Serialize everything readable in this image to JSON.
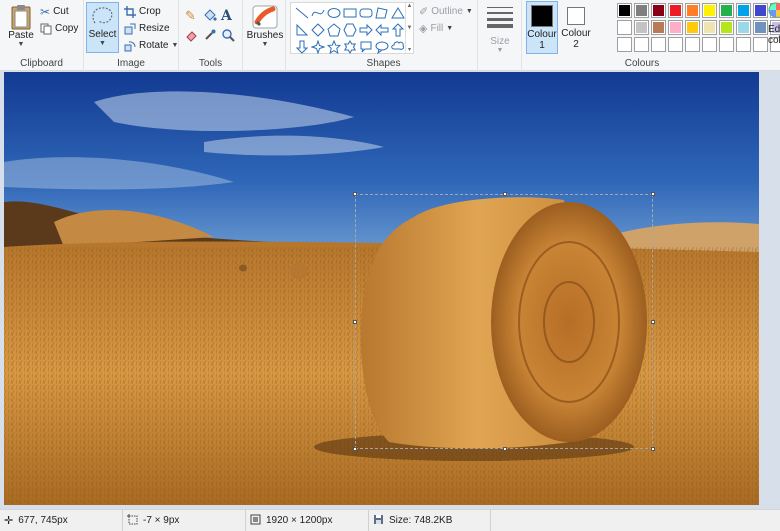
{
  "clipboard": {
    "paste": "Paste",
    "cut": "Cut",
    "copy": "Copy",
    "label": "Clipboard"
  },
  "image": {
    "select": "Select",
    "crop": "Crop",
    "resize": "Resize",
    "rotate": "Rotate",
    "label": "Image"
  },
  "tools": {
    "label": "Tools",
    "items": [
      "pencil-icon",
      "fill-bucket-icon",
      "text-icon",
      "eraser-icon",
      "color-picker-icon",
      "magnifier-icon"
    ]
  },
  "brushes": {
    "label": "Brushes"
  },
  "shapes": {
    "label": "Shapes",
    "outline": "Outline",
    "fill": "Fill"
  },
  "size": {
    "label": "Size"
  },
  "colours": {
    "label": "Colours",
    "colour1": {
      "line1": "Colour",
      "line2": "1",
      "value": "#000000"
    },
    "colour2": {
      "line1": "Colour",
      "line2": "2",
      "value": "#ffffff"
    },
    "edit": {
      "line1": "Ed",
      "line2": "colo"
    },
    "palette": [
      "#000000",
      "#7f7f7f",
      "#880015",
      "#ed1c24",
      "#ff7f27",
      "#fff200",
      "#22b14c",
      "#00a2e8",
      "#3f48cc",
      "#a349a4",
      "#ffffff",
      "#c3c3c3",
      "#b97a57",
      "#ffaec9",
      "#ffc90e",
      "#efe4b0",
      "#b5e61d",
      "#99d9ea",
      "#7092be",
      "#c8bfe7",
      "#ffffff",
      "#ffffff",
      "#ffffff",
      "#ffffff",
      "#ffffff",
      "#ffffff",
      "#ffffff",
      "#ffffff",
      "#ffffff",
      "#ffffff"
    ]
  },
  "status": {
    "cursor_pos": "677, 745px",
    "selection_size": "-7 × 9px",
    "image_size": "1920 × 1200px",
    "file_size": "Size: 748.2KB"
  }
}
